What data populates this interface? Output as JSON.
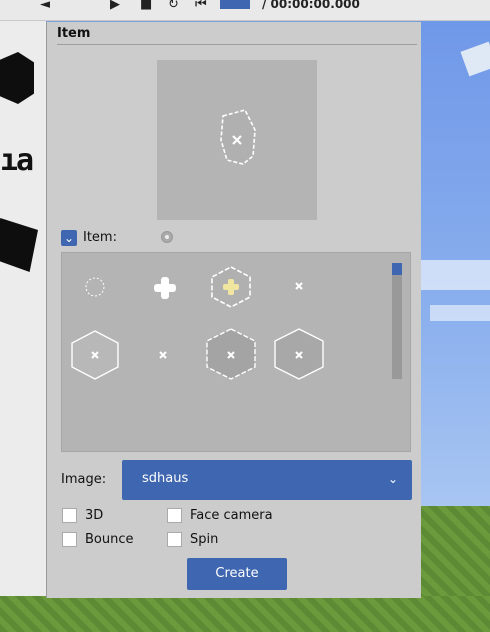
{
  "topbar": {
    "timecode": "/ 00:00:00.000"
  },
  "panel": {
    "title": "Item",
    "item_label": "Item:",
    "image_label": "Image:",
    "image_value": "sdhaus",
    "checkboxes": {
      "three_d": "3D",
      "face_camera": "Face camera",
      "bounce": "Bounce",
      "spin": "Spin"
    },
    "create_label": "Create"
  },
  "background": {
    "glyph": "ıa"
  },
  "colors": {
    "accent": "#3f66b0",
    "panel": "#cccccc",
    "well": "#b4b4b4"
  }
}
